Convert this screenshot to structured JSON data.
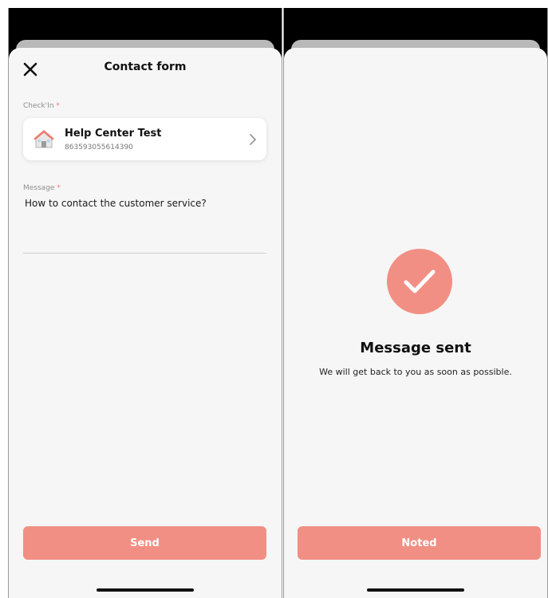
{
  "contact_form": {
    "title": "Contact form",
    "close_icon": "close-icon",
    "checkin": {
      "label": "Check'In",
      "required_mark": "*",
      "card_title": "Help Center Test",
      "card_id": "863593055614390",
      "icon": "house-icon"
    },
    "message": {
      "label": "Message",
      "required_mark": "*",
      "value": "How to contact the customer service?"
    },
    "send_label": "Send"
  },
  "confirmation": {
    "icon": "checkmark-icon",
    "title": "Message sent",
    "subtitle": "We will get back to you as soon as possible.",
    "noted_label": "Noted"
  },
  "colors": {
    "accent": "#f28f84",
    "sheet_bg": "#f6f6f6",
    "required": "#ef7a6e"
  }
}
